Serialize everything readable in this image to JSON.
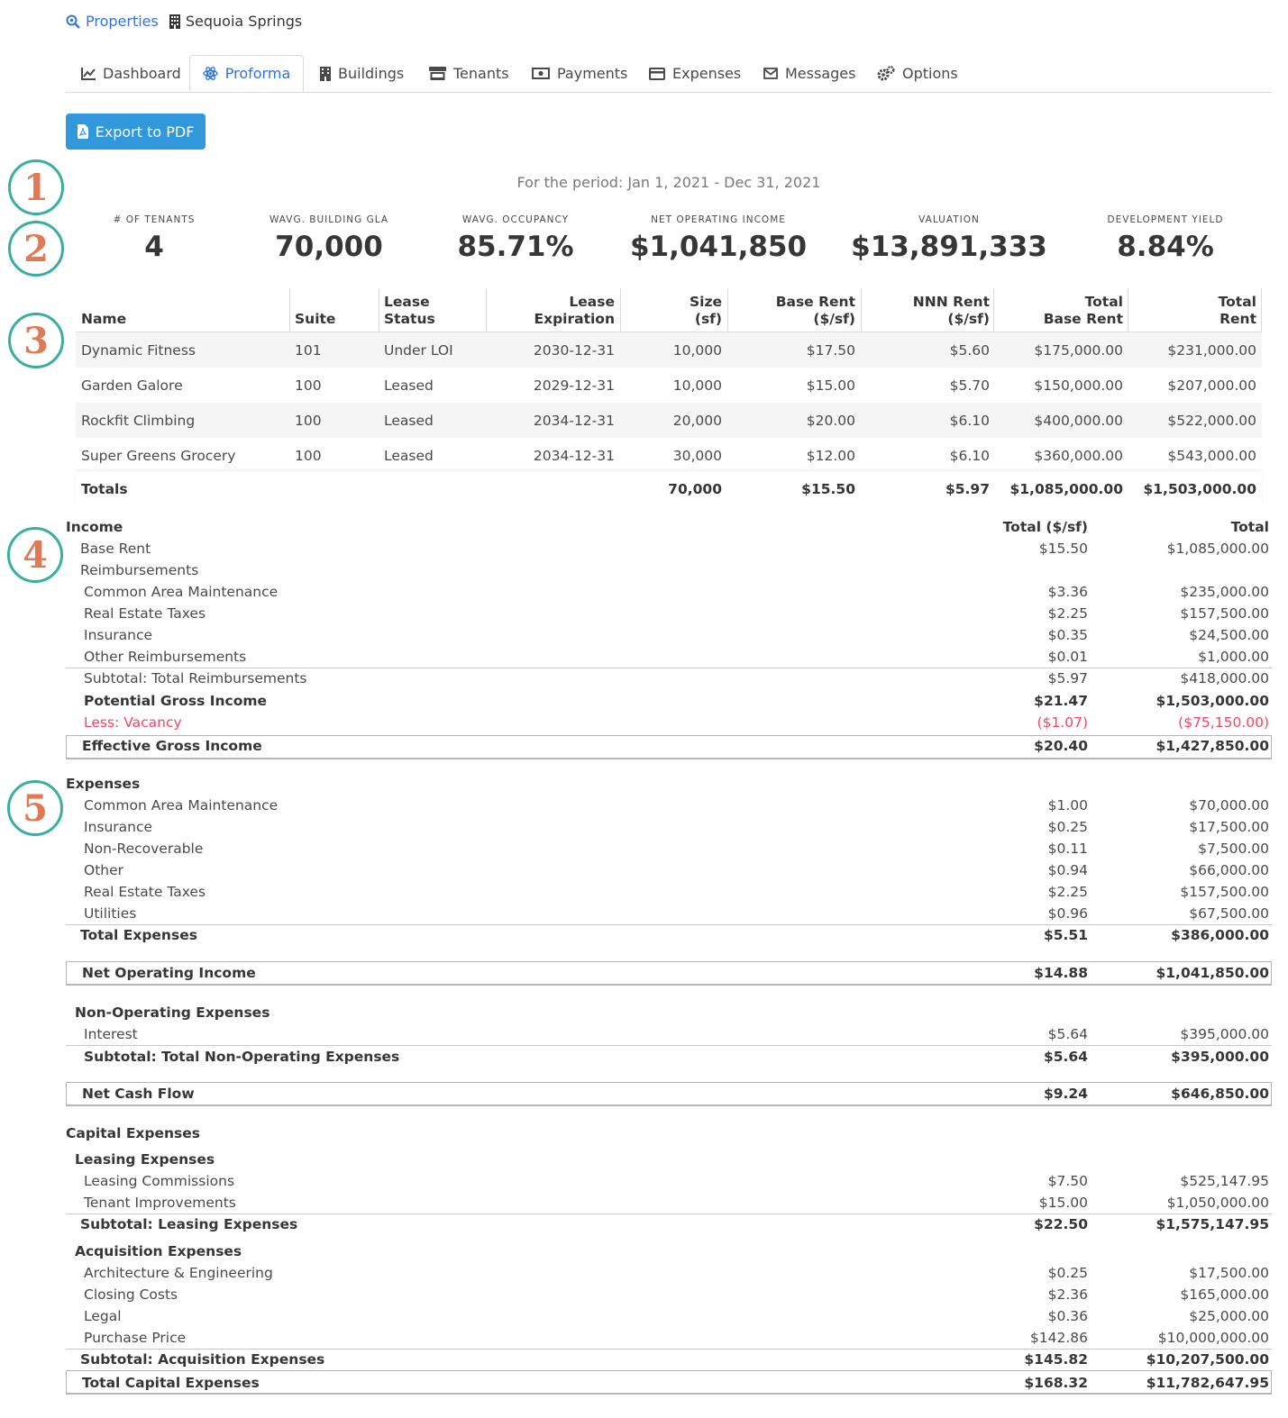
{
  "breadcrumb": {
    "root": "Properties",
    "current": "Sequoia Springs"
  },
  "tabs": [
    "Dashboard",
    "Proforma",
    "Buildings",
    "Tenants",
    "Payments",
    "Expenses",
    "Messages",
    "Options"
  ],
  "active_tab": "Proforma",
  "export_label": "Export to PDF",
  "period": "For the period: Jan 1, 2021 - Dec 31, 2021",
  "badges": [
    "1",
    "2",
    "3",
    "4",
    "5"
  ],
  "stats": [
    {
      "label": "# OF TENANTS",
      "value": "4"
    },
    {
      "label": "WAVG. BUILDING GLA",
      "value": "70,000"
    },
    {
      "label": "WAVG. OCCUPANCY",
      "value": "85.71%"
    },
    {
      "label": "NET OPERATING INCOME",
      "value": "$1,041,850"
    },
    {
      "label": "VALUATION",
      "value": "$13,891,333"
    },
    {
      "label": "DEVELOPMENT YIELD",
      "value": "8.84%"
    }
  ],
  "tenant_table": {
    "headers": [
      {
        "l1": "",
        "l2": "Name"
      },
      {
        "l1": "",
        "l2": "Suite"
      },
      {
        "l1": "Lease",
        "l2": "Status"
      },
      {
        "l1": "Lease",
        "l2": "Expiration"
      },
      {
        "l1": "Size",
        "l2": "(sf)"
      },
      {
        "l1": "Base Rent",
        "l2": "($/sf)"
      },
      {
        "l1": "NNN Rent",
        "l2": "($/sf)"
      },
      {
        "l1": "Total",
        "l2": "Base Rent"
      },
      {
        "l1": "Total",
        "l2": "Rent"
      }
    ],
    "rows": [
      [
        "Dynamic Fitness",
        "101",
        "Under LOI",
        "2030-12-31",
        "10,000",
        "$17.50",
        "$5.60",
        "$175,000.00",
        "$231,000.00"
      ],
      [
        "Garden Galore",
        "100",
        "Leased",
        "2029-12-31",
        "10,000",
        "$15.00",
        "$5.70",
        "$150,000.00",
        "$207,000.00"
      ],
      [
        "Rockfit Climbing",
        "100",
        "Leased",
        "2034-12-31",
        "20,000",
        "$20.00",
        "$6.10",
        "$400,000.00",
        "$522,000.00"
      ],
      [
        "Super Greens Grocery",
        "100",
        "Leased",
        "2034-12-31",
        "30,000",
        "$12.00",
        "$6.10",
        "$360,000.00",
        "$543,000.00"
      ]
    ],
    "totals": [
      "Totals",
      "",
      "",
      "",
      "70,000",
      "$15.50",
      "$5.97",
      "$1,085,000.00",
      "$1,503,000.00"
    ]
  },
  "statement": {
    "col_psf": "Total ($/sf)",
    "col_total": "Total",
    "lines": [
      {
        "label": "Income",
        "style": "bold"
      },
      {
        "label": "Base Rent",
        "psf": "$15.50",
        "total": "$1,085,000.00"
      },
      {
        "label": "Reimbursements"
      },
      {
        "label": "Common Area Maintenance",
        "psf": "$3.36",
        "total": "$235,000.00"
      },
      {
        "label": "Real Estate Taxes",
        "psf": "$2.25",
        "total": "$157,500.00"
      },
      {
        "label": "Insurance",
        "psf": "$0.35",
        "total": "$24,500.00"
      },
      {
        "label": "Other Reimbursements",
        "psf": "$0.01",
        "total": "$1,000.00"
      },
      {
        "label": "Subtotal: Total Reimbursements",
        "psf": "$5.97",
        "total": "$418,000.00"
      },
      {
        "label": "Potential Gross Income",
        "psf": "$21.47",
        "total": "$1,503,000.00",
        "style": "bold"
      },
      {
        "label": "Less: Vacancy",
        "psf": "($1.07)",
        "total": "($75,150.00)",
        "style": "red"
      },
      {
        "label": "Effective Gross Income",
        "psf": "$20.40",
        "total": "$1,427,850.00",
        "style": "bold"
      },
      {
        "label": "Expenses",
        "style": "bold"
      },
      {
        "label": "Common Area Maintenance",
        "psf": "$1.00",
        "total": "$70,000.00"
      },
      {
        "label": "Insurance",
        "psf": "$0.25",
        "total": "$17,500.00"
      },
      {
        "label": "Non-Recoverable",
        "psf": "$0.11",
        "total": "$7,500.00"
      },
      {
        "label": "Other",
        "psf": "$0.94",
        "total": "$66,000.00"
      },
      {
        "label": "Real Estate Taxes",
        "psf": "$2.25",
        "total": "$157,500.00"
      },
      {
        "label": "Utilities",
        "psf": "$0.96",
        "total": "$67,500.00"
      },
      {
        "label": "Total Expenses",
        "psf": "$5.51",
        "total": "$386,000.00",
        "style": "bold"
      },
      {
        "label": "Net Operating Income",
        "psf": "$14.88",
        "total": "$1,041,850.00",
        "style": "bold"
      },
      {
        "label": "Non-Operating Expenses",
        "style": "bold"
      },
      {
        "label": "Interest",
        "psf": "$5.64",
        "total": "$395,000.00"
      },
      {
        "label": "Subtotal: Total Non-Operating Expenses",
        "psf": "$5.64",
        "total": "$395,000.00",
        "style": "bold"
      },
      {
        "label": "Net Cash Flow",
        "psf": "$9.24",
        "total": "$646,850.00",
        "style": "bold"
      },
      {
        "label": "Capital Expenses",
        "style": "bold"
      },
      {
        "label": "Leasing Expenses",
        "style": "bold"
      },
      {
        "label": "Leasing Commissions",
        "psf": "$7.50",
        "total": "$525,147.95"
      },
      {
        "label": "Tenant Improvements",
        "psf": "$15.00",
        "total": "$1,050,000.00"
      },
      {
        "label": "Subtotal: Leasing Expenses",
        "psf": "$22.50",
        "total": "$1,575,147.95",
        "style": "bold"
      },
      {
        "label": "Acquisition Expenses",
        "style": "bold"
      },
      {
        "label": "Architecture & Engineering",
        "psf": "$0.25",
        "total": "$17,500.00"
      },
      {
        "label": "Closing Costs",
        "psf": "$2.36",
        "total": "$165,000.00"
      },
      {
        "label": "Legal",
        "psf": "$0.36",
        "total": "$25,000.00"
      },
      {
        "label": "Purchase Price",
        "psf": "$142.86",
        "total": "$10,000,000.00"
      },
      {
        "label": "Subtotal: Acquisition Expenses",
        "psf": "$145.82",
        "total": "$10,207,500.00",
        "style": "bold"
      },
      {
        "label": "Total Capital Expenses",
        "psf": "$168.32",
        "total": "$11,782,647.95",
        "style": "bold"
      }
    ]
  }
}
